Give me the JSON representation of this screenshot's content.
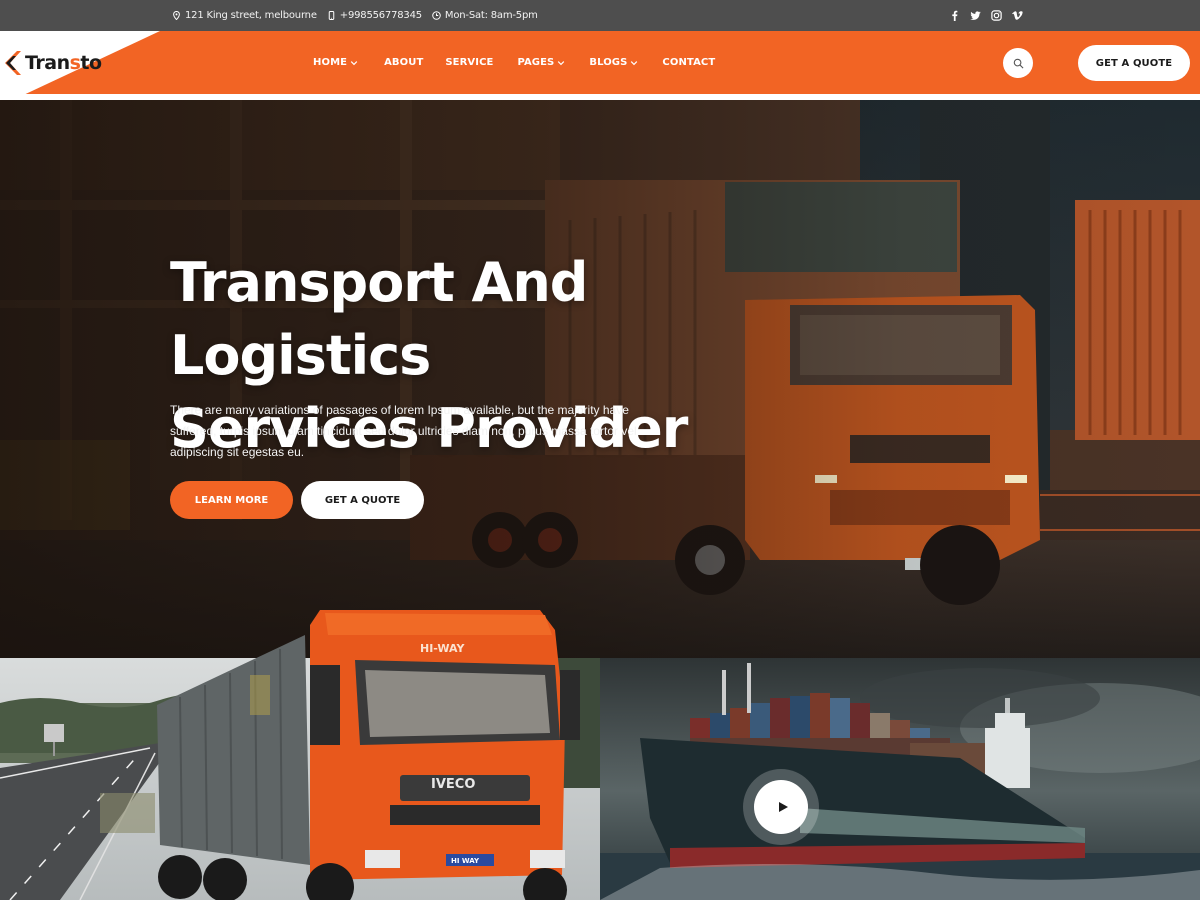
{
  "topbar": {
    "address": "121 King street, melbourne",
    "phone": "+998556778345",
    "hours": "Mon-Sat: 8am-5pm",
    "social_icons": [
      "facebook-icon",
      "twitter-icon",
      "instagram-icon",
      "vimeo-icon"
    ]
  },
  "brand": {
    "name_prefix": "Tran",
    "name_accent": "s",
    "name_suffix": "to",
    "accent_color": "#f26424"
  },
  "nav": {
    "items": [
      {
        "label": "HOME",
        "has_dropdown": true
      },
      {
        "label": "ABOUT",
        "has_dropdown": false
      },
      {
        "label": "SERVICE",
        "has_dropdown": false
      },
      {
        "label": "PAGES",
        "has_dropdown": true
      },
      {
        "label": "BLOGS",
        "has_dropdown": true
      },
      {
        "label": "CONTACT",
        "has_dropdown": false
      }
    ],
    "quote_button": "GET A QUOTE"
  },
  "hero": {
    "title_line1": "Transport And Logistics",
    "title_line2": "Services Provider",
    "text": "There are many variations of passages of lorem Ipsum available, but the majority have suffered, turpis ipsum diam tincidunt sed dolor ultricies diam non, purus massa tortor vel adipiscing sit egestas eu.",
    "primary_button": "LEARN MORE",
    "secondary_button": "GET A QUOTE"
  },
  "truck": {
    "grille_text": "IVECO",
    "visor_text": "HI-WAY",
    "plate": "HI WAY"
  },
  "colors": {
    "topbar": "#4e4e4e",
    "header": "#f26424",
    "white": "#ffffff",
    "dark": "#1b1b1b"
  }
}
